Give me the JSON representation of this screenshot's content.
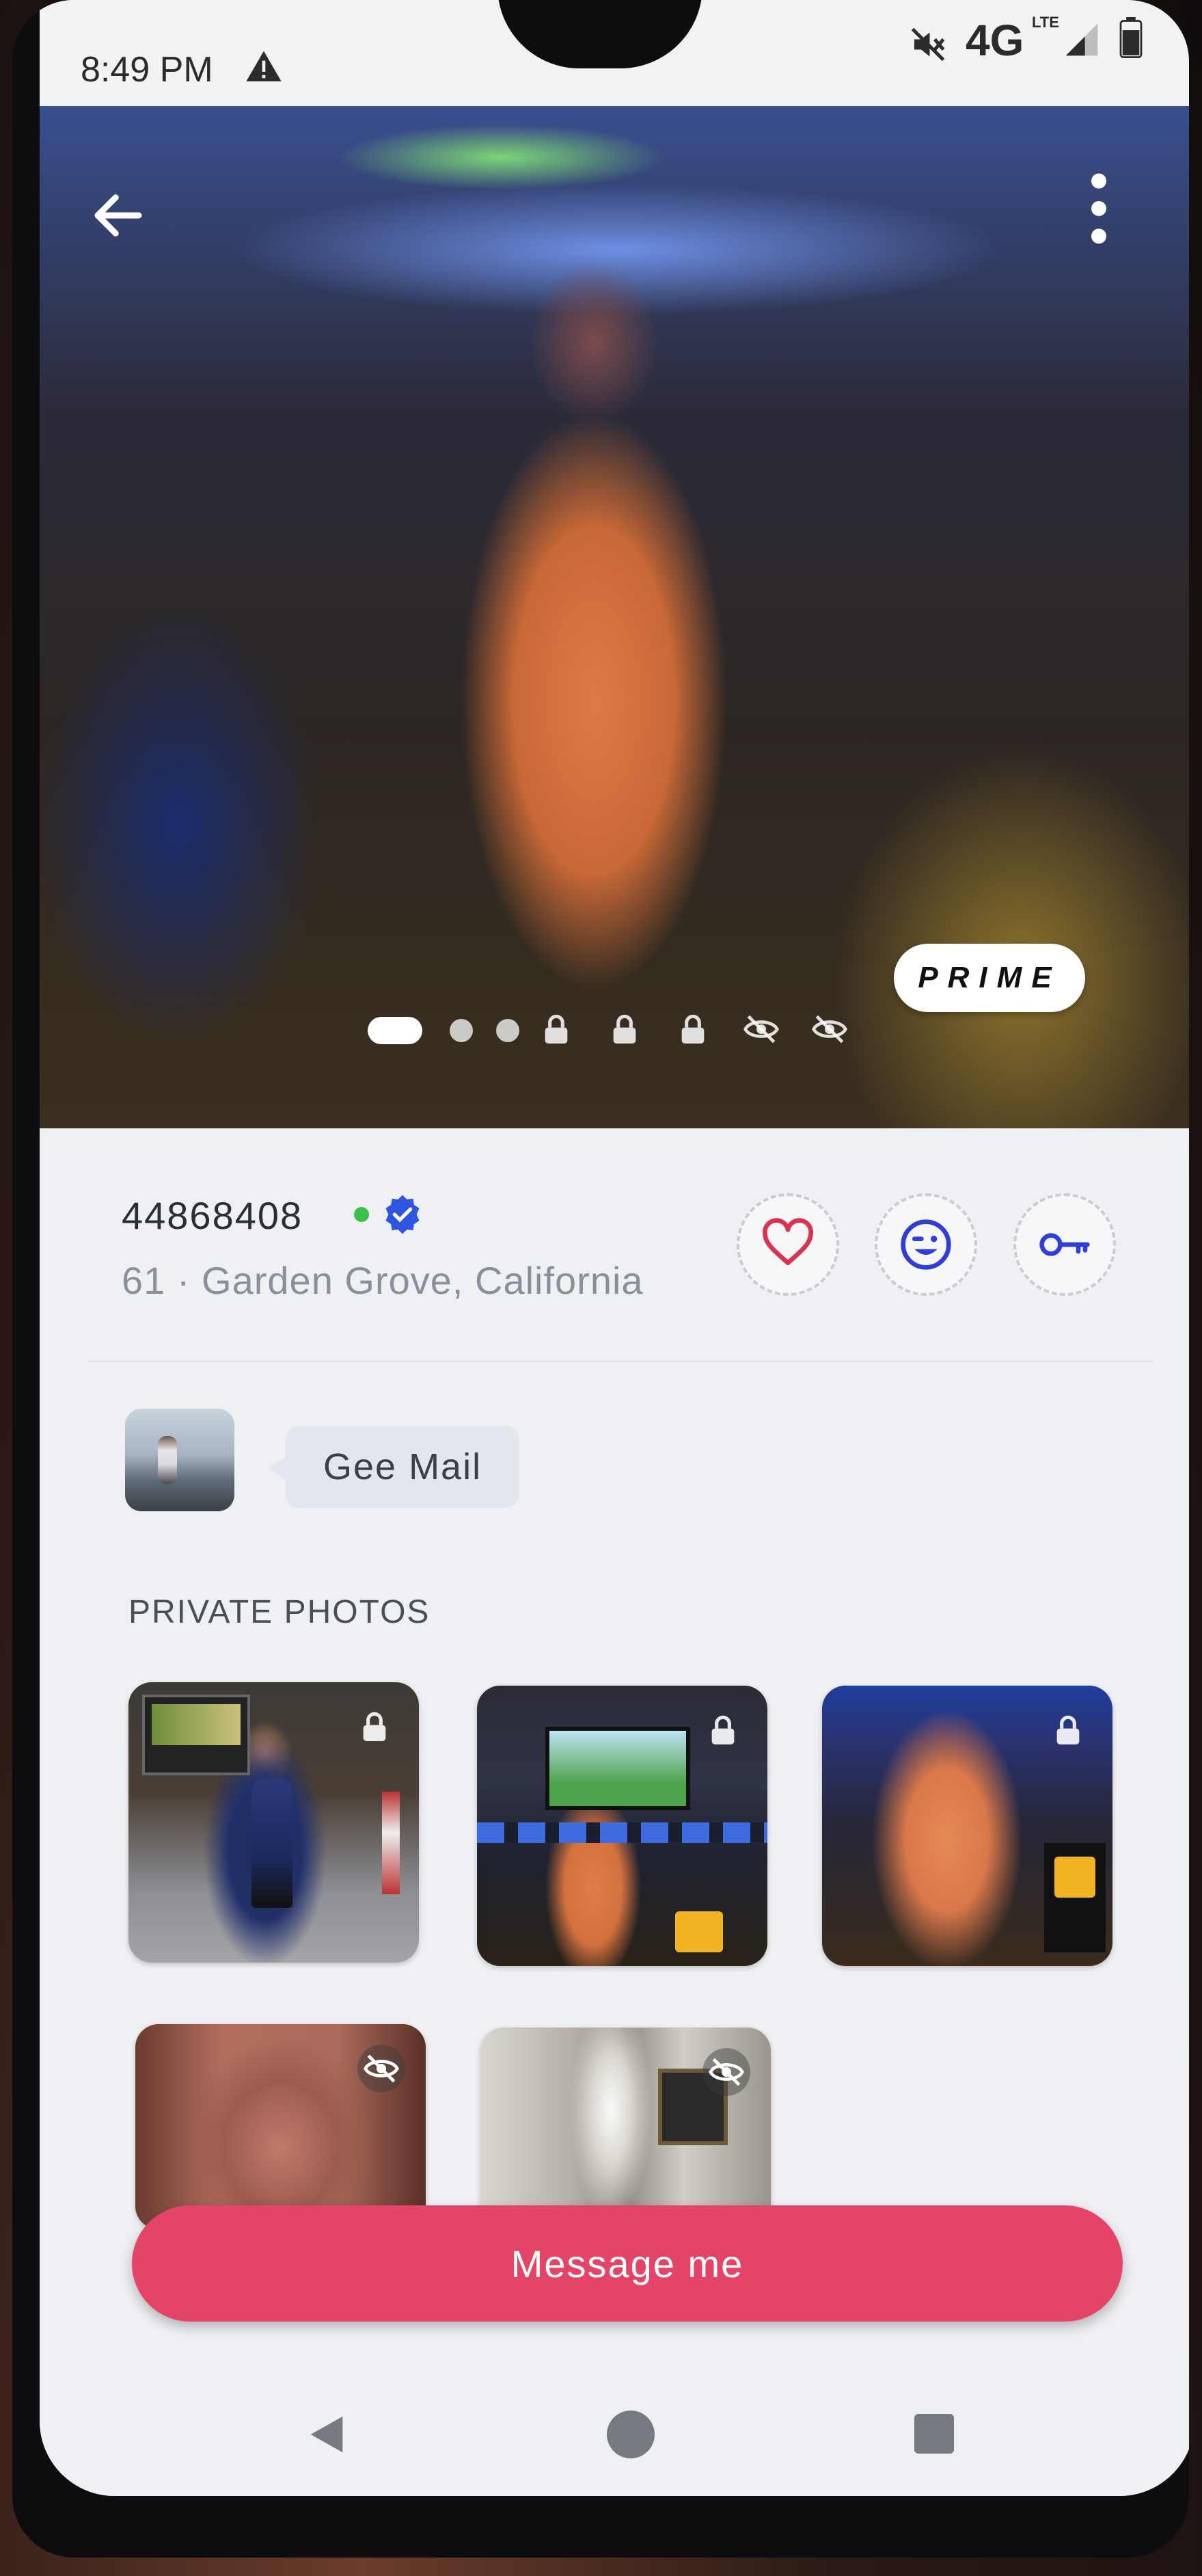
{
  "status_bar": {
    "time": "8:49 PM",
    "network": "4G",
    "network_sub": "LTE",
    "icons": [
      "warning-icon",
      "mute-icon",
      "signal-icon",
      "battery-icon"
    ]
  },
  "hero": {
    "badge": "PRIME",
    "photo_indicators": [
      {
        "type": "active"
      },
      {
        "type": "dot"
      },
      {
        "type": "dot"
      },
      {
        "type": "lock-icon"
      },
      {
        "type": "lock-icon"
      },
      {
        "type": "lock-icon"
      },
      {
        "type": "eye-off-icon"
      },
      {
        "type": "eye-off-icon"
      }
    ]
  },
  "profile": {
    "username": "44868408",
    "online": true,
    "verified": true,
    "location": "61 · Garden Grove, California",
    "actions": [
      {
        "name": "like-button",
        "icon": "heart-icon",
        "color": "#d9334f"
      },
      {
        "name": "wink-button",
        "icon": "wink-face-icon",
        "color": "#2f3ed6"
      },
      {
        "name": "key-button",
        "icon": "key-icon",
        "color": "#2f3ed6"
      }
    ]
  },
  "mail": {
    "label": "Gee Mail"
  },
  "private_photos": {
    "title": "PRIVATE PHOTOS",
    "items": [
      {
        "icon": "lock-icon"
      },
      {
        "icon": "lock-icon"
      },
      {
        "icon": "lock-icon"
      },
      {
        "icon": "eye-off-icon"
      },
      {
        "icon": "eye-off-icon"
      }
    ]
  },
  "cta": {
    "label": "Message me",
    "color": "#e44468"
  },
  "navbar": {
    "icons": [
      "back-triangle-icon",
      "home-circle-icon",
      "recents-square-icon"
    ]
  }
}
